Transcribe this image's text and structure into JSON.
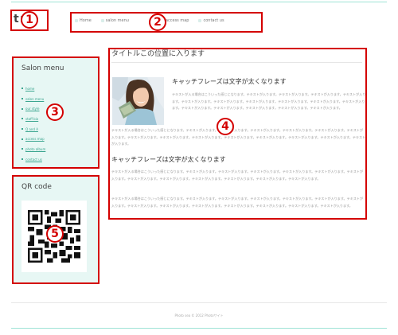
{
  "logo": {
    "text": "t:"
  },
  "nav": {
    "items": [
      "Home",
      "salon menu",
      "access map",
      "contact us"
    ]
  },
  "sidebar": {
    "menu_title": "Salon menu",
    "menu_items": [
      "home",
      "salon menu",
      "our style",
      "staff bio",
      "Q and A",
      "access map",
      "photo album",
      "contact us"
    ],
    "qr_title": "QR code"
  },
  "main": {
    "title": "タイトルこの位置に入ります",
    "catch1": "キャッチフレーズは文字が太くなります",
    "body1": "テキストが入る場合はこういった感じになります。テキストが入ります。テキストが入ります。テキストが入ります。テキストが入ります。テキストが入ります。テキストが入ります。テキストが入ります。テキストが入ります。テキストが入ります。テキストが入ります。テキストが入ります。テキストが入ります。テキストが入ります。テキストが入ります。テキストが入ります。",
    "body2": "テキストが入る場合はこういった感じになります。テキストが入ります。テキストが入ります。テキストが入ります。テキストが入ります。テキストが入ります。テキストが入ります。テキストが入ります。テキストが入ります。テキストが入ります。テキストが入ります。テキストが入ります。テキストが入ります。テキストが入ります。テキストが入ります。",
    "catch2": "キャッチフレーズは文字が太くなります",
    "body3": "テキストが入る場合はこういった感じになります。テキストが入ります。テキストが入ります。テキストが入ります。テキストが入ります。テキストが入ります。テキストが入ります。テキストが入ります。テキストが入ります。テキストが入ります。テキストが入ります。テキストが入ります。テキストが入ります。",
    "body4": "テキストが入る場合はこういった感じになります。テキストが入ります。テキストが入ります。テキストが入ります。テキストが入ります。テキストが入ります。テキストが入ります。テキストが入ります。テキストが入ります。テキストが入ります。テキストが入ります。テキストが入ります。テキストが入ります。テキストが入ります。"
  },
  "footer": {
    "copyright": "Photo sea © 2012 Photoサイト"
  },
  "annotations": [
    "1",
    "2",
    "3",
    "4",
    "5"
  ],
  "colors": {
    "accent": "#9fe3d6",
    "panel": "#e7f7f4",
    "annotation": "#d40000",
    "link": "#3aa58f"
  }
}
